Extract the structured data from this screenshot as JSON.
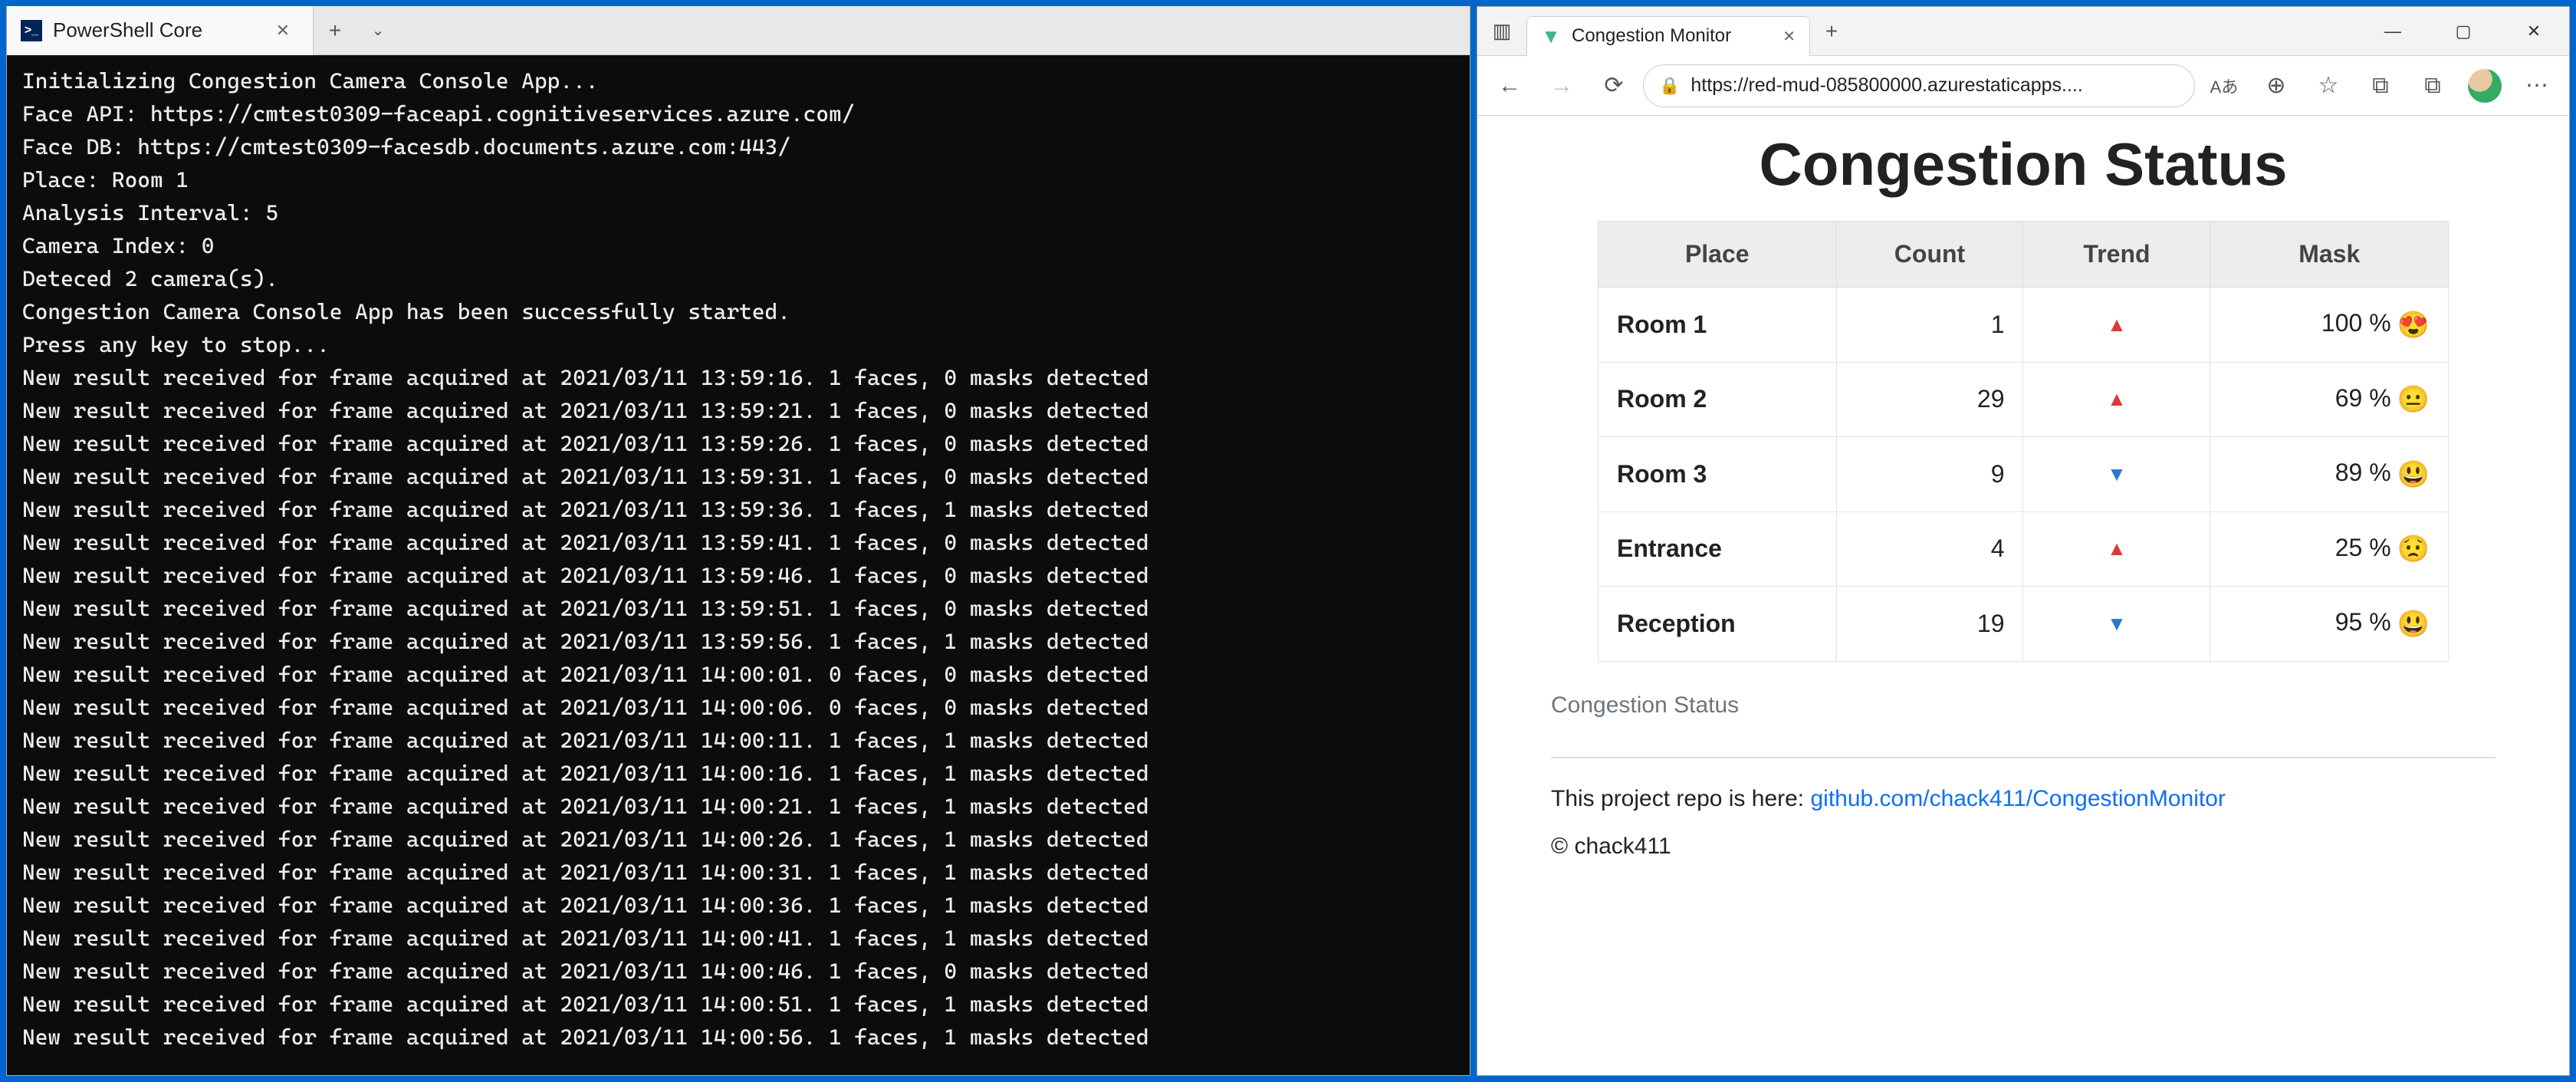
{
  "powershell": {
    "tab_title": "PowerShell Core",
    "icon_glyph": ">_",
    "lines": [
      "Initializing Congestion Camera Console App...",
      "Face API: https://cmtest0309-faceapi.cognitiveservices.azure.com/",
      "Face DB: https://cmtest0309-facesdb.documents.azure.com:443/",
      "Place: Room 1",
      "Analysis Interval: 5",
      "Camera Index: 0",
      "Deteced 2 camera(s).",
      "Congestion Camera Console App has been successfully started.",
      "Press any key to stop...",
      "New result received for frame acquired at 2021/03/11 13:59:16. 1 faces, 0 masks detected",
      "New result received for frame acquired at 2021/03/11 13:59:21. 1 faces, 0 masks detected",
      "New result received for frame acquired at 2021/03/11 13:59:26. 1 faces, 0 masks detected",
      "New result received for frame acquired at 2021/03/11 13:59:31. 1 faces, 0 masks detected",
      "New result received for frame acquired at 2021/03/11 13:59:36. 1 faces, 1 masks detected",
      "New result received for frame acquired at 2021/03/11 13:59:41. 1 faces, 0 masks detected",
      "New result received for frame acquired at 2021/03/11 13:59:46. 1 faces, 0 masks detected",
      "New result received for frame acquired at 2021/03/11 13:59:51. 1 faces, 0 masks detected",
      "New result received for frame acquired at 2021/03/11 13:59:56. 1 faces, 1 masks detected",
      "New result received for frame acquired at 2021/03/11 14:00:01. 0 faces, 0 masks detected",
      "New result received for frame acquired at 2021/03/11 14:00:06. 0 faces, 0 masks detected",
      "New result received for frame acquired at 2021/03/11 14:00:11. 1 faces, 1 masks detected",
      "New result received for frame acquired at 2021/03/11 14:00:16. 1 faces, 1 masks detected",
      "New result received for frame acquired at 2021/03/11 14:00:21. 1 faces, 1 masks detected",
      "New result received for frame acquired at 2021/03/11 14:00:26. 1 faces, 1 masks detected",
      "New result received for frame acquired at 2021/03/11 14:00:31. 1 faces, 1 masks detected",
      "New result received for frame acquired at 2021/03/11 14:00:36. 1 faces, 1 masks detected",
      "New result received for frame acquired at 2021/03/11 14:00:41. 1 faces, 1 masks detected",
      "New result received for frame acquired at 2021/03/11 14:00:46. 1 faces, 0 masks detected",
      "New result received for frame acquired at 2021/03/11 14:00:51. 1 faces, 1 masks detected",
      "New result received for frame acquired at 2021/03/11 14:00:56. 1 faces, 1 masks detected"
    ]
  },
  "browser": {
    "tab_title": "Congestion Monitor",
    "url_host": "https://red-mud-085800000.azurestaticapps....",
    "toolbar_icon_glyphs": {
      "tabside": "▥",
      "back": "←",
      "forward": "→",
      "refresh": "⟳",
      "lock": "🔒",
      "read_aloud": "Aあ",
      "zoom": "⊕",
      "favorite": "☆",
      "tracking": "⧉",
      "collections": "⧉",
      "menu": "⋯"
    },
    "win_controls": {
      "min": "—",
      "max": "▢",
      "close": "✕"
    }
  },
  "page": {
    "title": "Congestion Status",
    "columns": [
      "Place",
      "Count",
      "Trend",
      "Mask"
    ],
    "rows": [
      {
        "place": "Room 1",
        "count": "1",
        "trend": "up",
        "mask": "100 %",
        "emoji": "😍"
      },
      {
        "place": "Room 2",
        "count": "29",
        "trend": "up",
        "mask": "69 %",
        "emoji": "😐"
      },
      {
        "place": "Room 3",
        "count": "9",
        "trend": "down",
        "mask": "89 %",
        "emoji": "😃"
      },
      {
        "place": "Entrance",
        "count": "4",
        "trend": "up",
        "mask": "25 %",
        "emoji": "😟"
      },
      {
        "place": "Reception",
        "count": "19",
        "trend": "down",
        "mask": "95 %",
        "emoji": "😃"
      }
    ],
    "caption": "Congestion Status",
    "repo_prefix": "This project repo is here: ",
    "repo_link_text": "github.com/chack411/CongestionMonitor",
    "copyright": "© chack411"
  }
}
